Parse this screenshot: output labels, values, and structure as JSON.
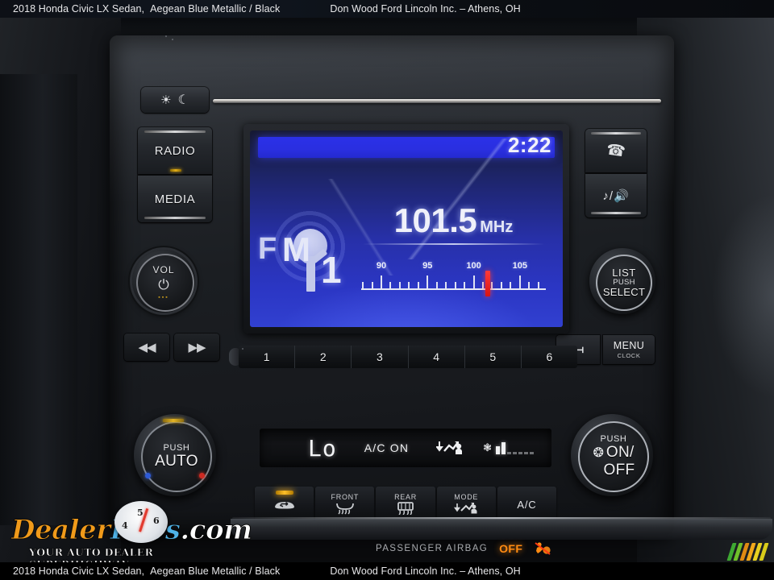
{
  "caption": {
    "vehicle": "2018 Honda Civic LX Sedan,",
    "color": "Aegean Blue Metallic / Black",
    "dealer": "Don Wood Ford Lincoln Inc. – Athens, OH"
  },
  "head_unit": {
    "brightness_button": {
      "name": "display-brightness",
      "sun": "☀",
      "moon": "☾"
    },
    "radio_button": "RADIO",
    "media_button": "MEDIA",
    "volume_knob": {
      "label": "VOL",
      "power_glyph": "⏻",
      "dots": "▪▪▪"
    },
    "skip_prev": "◀◀",
    "skip_next": "▶▶",
    "phone_button": "phone-icon",
    "audio_button": "♪/◀",
    "list_knob": {
      "line1": "LIST",
      "line2": "PUSH",
      "line3": "SELECT"
    },
    "back_button": "↰",
    "menu_button": {
      "line1": "MENU",
      "line2": "CLOCK"
    },
    "presets": [
      "1",
      "2",
      "3",
      "4",
      "5",
      "6"
    ]
  },
  "screen": {
    "clock": "2:22",
    "band": "FM",
    "band_number": "1",
    "frequency": "101.5",
    "unit": "MHz",
    "scale": {
      "labels": [
        "90",
        "95",
        "100",
        "105"
      ],
      "min": 87.9,
      "max": 107.9,
      "tuned": 101.5
    },
    "accent_blue": "#2b30e8",
    "tuner_red": "#ff3a3a"
  },
  "climate": {
    "temperature": "Lo",
    "ac_status": "A/C ON",
    "mode_icon": "airflow-face-floor-icon",
    "fan_icon": "fan-icon",
    "fan_level": 2,
    "fan_total": 7,
    "left_knob": {
      "push": "PUSH",
      "main": "AUTO"
    },
    "right_knob": {
      "push": "PUSH",
      "main": "ON/",
      "main2": "OFF"
    },
    "buttons": [
      {
        "name": "recirculation",
        "top": "",
        "label": "",
        "icon": "recirculate-car-icon",
        "led": true
      },
      {
        "name": "front-defrost",
        "top": "FRONT",
        "label": "",
        "icon": "front-defrost-icon",
        "led": false
      },
      {
        "name": "rear-defrost",
        "top": "REAR",
        "label": "",
        "icon": "rear-defrost-icon",
        "led": false
      },
      {
        "name": "mode",
        "top": "MODE",
        "label": "",
        "icon": "airflow-mode-icon",
        "led": false
      },
      {
        "name": "ac",
        "top": "",
        "label": "A/C",
        "icon": "",
        "led": false
      }
    ]
  },
  "airbag": {
    "label": "PASSENGER AIRBAG",
    "status": "OFF",
    "status_color": "#ff8b12"
  },
  "watermark": {
    "part1": "D",
    "part2": "ealer",
    "part3": "R",
    "part4": "evs",
    "part5": ".com",
    "tagline": "YOUR AUTO DEALER SUPERHIGHWAY",
    "gauge_numbers": [
      "4",
      "5",
      "6"
    ]
  },
  "color_bars": [
    "#3ea832",
    "#6fc02a",
    "#e08a12",
    "#f2a81a",
    "#e8d020",
    "#d9cc1a"
  ]
}
